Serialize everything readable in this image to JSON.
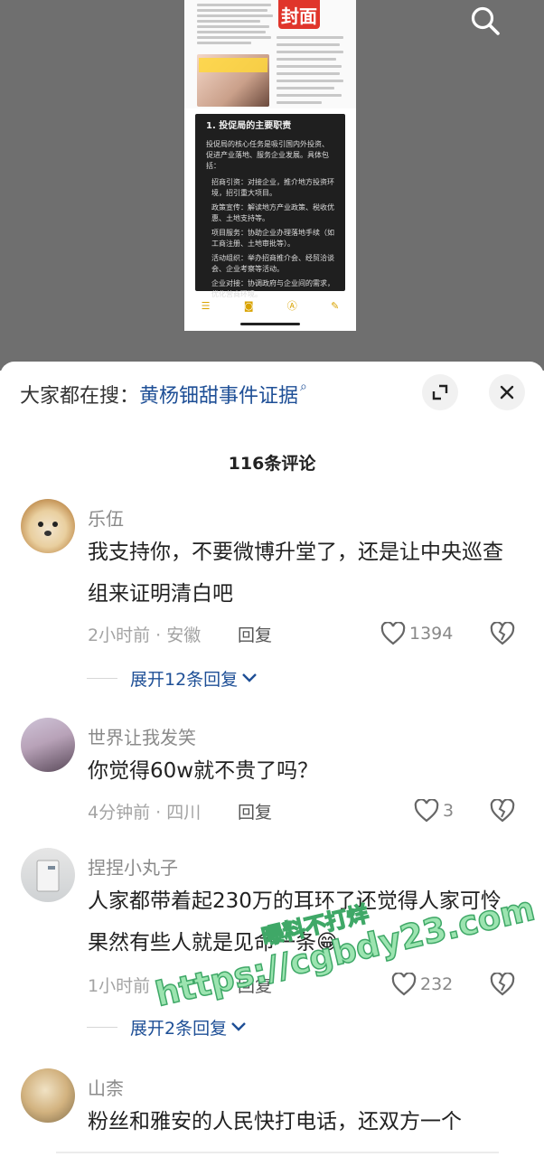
{
  "video": {
    "doc_title": "封面",
    "card_heading": "1. 投促局的主要职责",
    "card_intro": "投促局的核心任务是吸引国内外投资、促进产业落地、服务企业发展。具体包括：",
    "card_items": [
      "招商引资：对接企业，推介地方投资环境，招引重大项目。",
      "政策宣传：解读地方产业政策、税收优惠、土地支持等。",
      "项目服务：协助企业办理落地手续（如工商注册、土地审批等）。",
      "活动组织：举办招商推介会、经贸洽谈会、企业考察等活动。",
      "企业对接：协调政府与企业间的需求，优化营商环境。"
    ]
  },
  "suggest": {
    "prefix": "大家都在搜：",
    "term": "黄杨钿甜事件证据",
    "search_symbol": "⌕"
  },
  "comment_count": "116条评论",
  "comments": [
    {
      "name": "乐伍",
      "text": "我支持你，不要微博升堂了，还是让中央巡查组来证明清白吧",
      "meta": "2小时前 · 安徽",
      "reply": "回复",
      "likes": "1394",
      "expand": "展开12条回复"
    },
    {
      "name": "世界让我发笑",
      "text": "你觉得60w就不贵了吗？",
      "meta": "4分钟前 · 四川",
      "reply": "回复",
      "likes": "3"
    },
    {
      "name": "捏捏小丸子",
      "text": "人家都带着起230万的耳环了还觉得人家可怜果然有些人就是见命一条😁",
      "meta": "1小时前",
      "reply": "回复",
      "likes": "232",
      "expand": "展开2条回复"
    },
    {
      "name": "山柰",
      "text": "粉丝和雅安的人民快打电话，还双方一个"
    }
  ],
  "watermark": {
    "line1": "曝料不打烊",
    "line2": "https://cgbdy23.com"
  }
}
